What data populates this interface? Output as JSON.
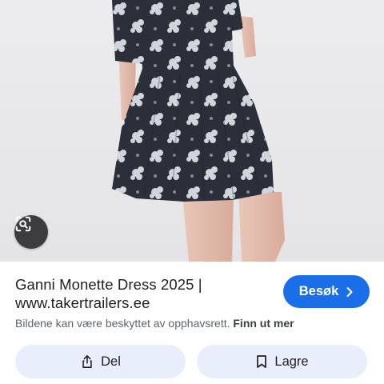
{
  "product": {
    "title_line1": "Ganni Monette Dress 2025 |",
    "title_line2": "www.takertrailers.ee"
  },
  "visit_button": {
    "label": "Besøk",
    "icon": "chevron-right-icon"
  },
  "notice": {
    "text": "Bildene kan være beskyttet av opphavsrett.",
    "link": "Finn ut mer"
  },
  "actions": {
    "share_label": "Del",
    "share_icon": "share-icon",
    "save_label": "Lagre",
    "save_icon": "bookmark-icon"
  },
  "lens": {
    "icon": "lens-search-icon"
  },
  "colors": {
    "accent": "#1a6fe8",
    "pill_background": "#e8eefb",
    "dress": "#2a2f3a"
  }
}
